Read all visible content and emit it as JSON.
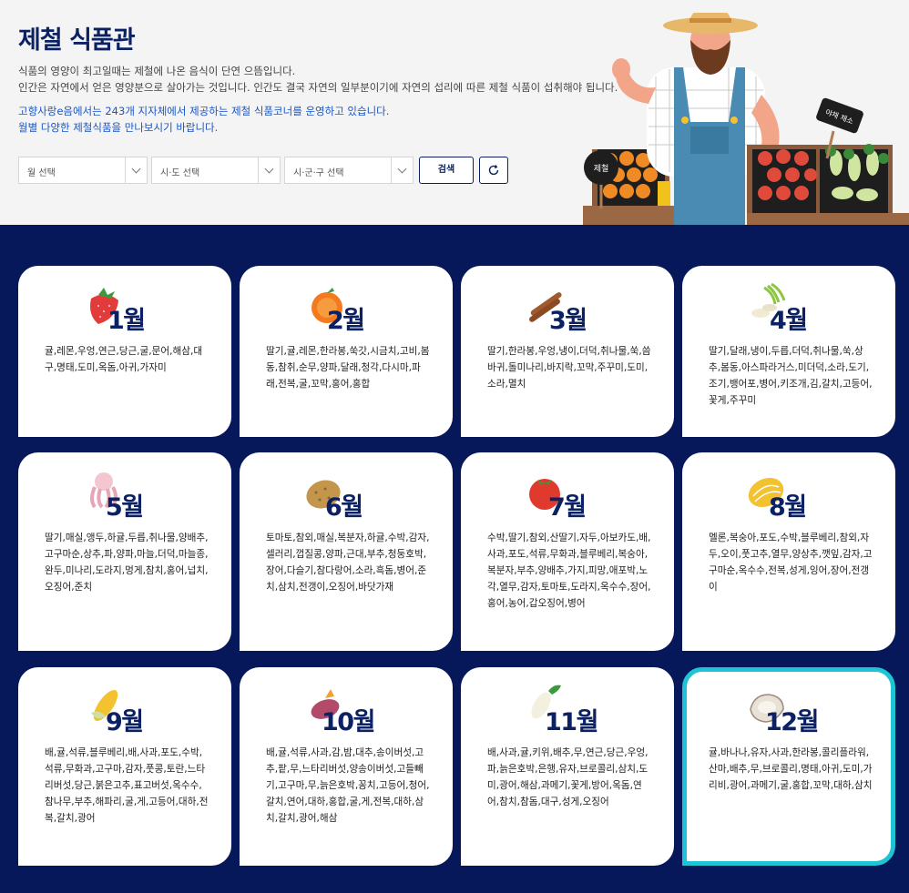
{
  "header": {
    "title": "제철 식품관",
    "desc_lines": [
      "식품의 영양이 최고일때는 제철에 나온 음식이 단연 으뜸입니다.",
      "인간은 자연에서 얻은 영양분으로 살아가는 것입니다. 인간도 결국 자연의 일부분이기에 자연의 섭리에 따른 제철 식품이 섭취해야 됩니다."
    ],
    "highlight_lines": [
      "고향사랑e음에서는 243개 지자체에서 제공하는 제철 식품코너를 운영하고 있습니다.",
      "월별 다양한 제철식품을 만나보시기 바랍니다."
    ]
  },
  "filters": {
    "month_placeholder": "월 선택",
    "province_placeholder": "시·도 선택",
    "city_placeholder": "시·군·구 선택",
    "search_label": "검색"
  },
  "illustration": {
    "sign_left": "제철",
    "sign_right": "야채 채소"
  },
  "colors": {
    "navy": "#0b2163",
    "grid_bg": "#06185a",
    "active_border": "#1fc4d4",
    "link_blue": "#1a56c4"
  },
  "months": [
    {
      "label": "1월",
      "icon": "strawberry-icon",
      "items": "귤,레몬,우엉,연근,당근,굴,문어,해삼,대구,명태,도미,옥돔,아귀,가자미",
      "active": false
    },
    {
      "label": "2월",
      "icon": "orange-icon",
      "items": "딸기,귤,레몬,한라봉,쑥갓,시금치,고비,봄동,참취,순무,양파,달래,청각,다시마,파래,전복,굴,꼬막,홍어,홍합",
      "active": false
    },
    {
      "label": "3월",
      "icon": "cinnamon-icon",
      "items": "딸기,한라봉,우엉,냉이,더덕,취나물,쑥,씀바귀,돌미나리,바지락,꼬막,주꾸미,도미,소라,멸치",
      "active": false
    },
    {
      "label": "4월",
      "icon": "green-onion-icon",
      "items": "딸기,달래,냉이,두릅,더덕,취나물,쑥,상추,봄동,아스파라거스,미더덕,소라,도기,조기,뱅어포,병어,키조개,김,갈치,고등어,꽃게,주꾸미",
      "active": false
    },
    {
      "label": "5월",
      "icon": "octopus-icon",
      "items": "딸기,매실,앵두,하귤,두릅,취나물,양배추,고구마순,상추,파,양파,마늘,더덕,마늘종,완두,미나리,도라지,멍게,참치,홍어,넙치,오징어,준치",
      "active": false
    },
    {
      "label": "6월",
      "icon": "potato-icon",
      "items": "토마토,참외,매실,복분자,하귤,수박,감자,셀러리,껍질콩,양파,근대,부추,청둥호박,장어,다슬기,참다랑어,소라,흑돔,병어,준치,삼치,전갱이,오징어,바닷가재",
      "active": false
    },
    {
      "label": "7월",
      "icon": "tomato-icon",
      "items": "수박,딸기,참외,산딸기,자두,아보카도,배,사과,포도,석류,무화과,블루베리,복숭아,복분자,부추,양배추,가지,피망,애포박,노각,열무,감자,토마토,도라지,옥수수,장어,홍어,농어,갑오징어,병어",
      "active": false
    },
    {
      "label": "8월",
      "icon": "melon-icon",
      "items": "멜론,복숭아,포도,수박,블루베리,참외,자두,오이,풋고추,열무,양상추,깻잎,감자,고구마순,옥수수,전복,성게,잉어,장어,전갱이",
      "active": false
    },
    {
      "label": "9월",
      "icon": "corn-icon",
      "items": "배,귤,석류,블루베리,배,사과,포도,수박,석류,무화과,고구마,감자,풋콩,토란,느타리버섯,당근,붉은고추,표고버섯,옥수수,참나무,부추,해파리,굴,게,고등어,대하,전복,갈치,광어",
      "active": false
    },
    {
      "label": "10월",
      "icon": "sweet-potato-icon",
      "items": "배,귤,석류,사과,감,밤,대추,송이버섯,고추,팥,무,느타리버섯,양송이버섯,고들빼기,고구마,무,늙은호박,꽁치,고등어,청어,갈치,연어,대하,홍합,굴,게,전복,대하,삼치,갈치,광어,해삼",
      "active": false
    },
    {
      "label": "11월",
      "icon": "radish-icon",
      "items": "배,사과,귤,키위,배추,무,연근,당근,우엉,파,늙은호박,은행,유자,브로콜리,삼치,도미,광어,해삼,과메기,꽃게,방어,옥돔,연어,참치,참돔,대구,성게,오징어",
      "active": false
    },
    {
      "label": "12월",
      "icon": "oyster-icon",
      "items": "귤,바나나,유자,사과,한라봉,콜리플라워,산마,배추,무,브로콜리,명태,아귀,도미,가리비,광어,과메기,굴,홍합,꼬막,대하,삼치",
      "active": true
    }
  ]
}
